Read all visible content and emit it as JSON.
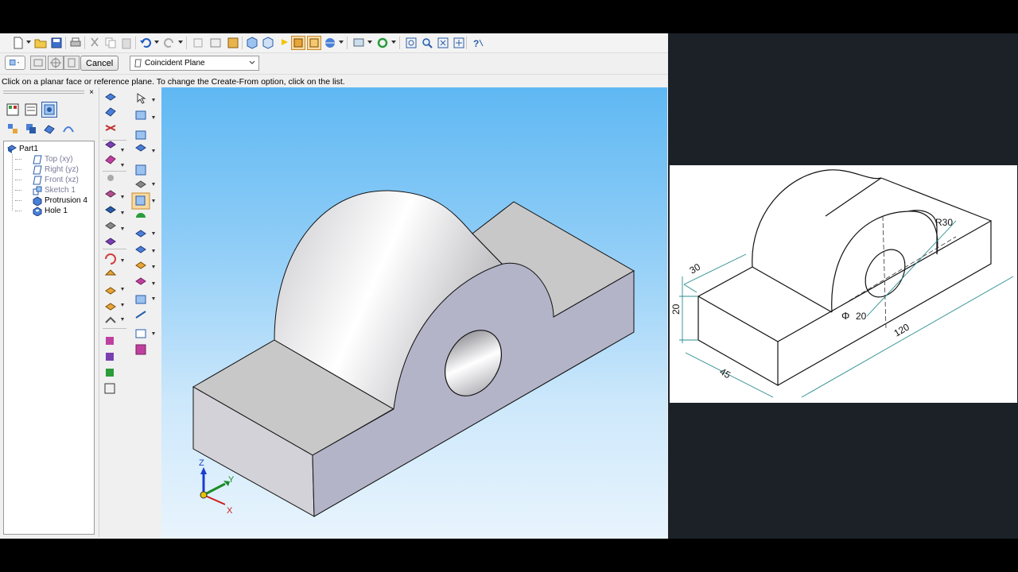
{
  "toolbar": {
    "commands": [
      "new-icon",
      "open-icon",
      "save-icon",
      "print-icon",
      "cut-icon",
      "copy-icon",
      "paste-icon",
      "undo-icon",
      "redo-icon",
      "zoom-icon",
      "fit-icon",
      "view-icon",
      "help-icon"
    ]
  },
  "command_bar": {
    "cancel_label": "Cancel",
    "create_from_value": "Coincident Plane"
  },
  "prompt": "Click on a planar face or reference plane.  To change the Create-From option, click on the list.",
  "pathfinder": {
    "close_glyph": "×",
    "tree": [
      {
        "label": "Part1",
        "greyed": false
      },
      {
        "label": "Top (xy)",
        "greyed": true
      },
      {
        "label": "Right (yz)",
        "greyed": true
      },
      {
        "label": "Front (xz)",
        "greyed": true
      },
      {
        "label": "Sketch 1",
        "greyed": true
      },
      {
        "label": "Protrusion 4",
        "greyed": false
      },
      {
        "label": "Hole 1",
        "greyed": false
      }
    ]
  },
  "triad": {
    "z": "Z",
    "y": "Y",
    "x": "X"
  },
  "drawing": {
    "dim_radius": "R30",
    "dim_depth": "30",
    "dim_height": "20",
    "dim_hole": "20",
    "dim_hole_prefix": "Φ",
    "dim_width": "45",
    "dim_length": "120"
  },
  "colors": {
    "viewport_top": "#5fb8f3",
    "viewport_bottom": "#e8f4fd",
    "model_face": "#b4b4c8",
    "dimension_line": "#2a8c8c",
    "active_tool": "#f8d9a0"
  }
}
